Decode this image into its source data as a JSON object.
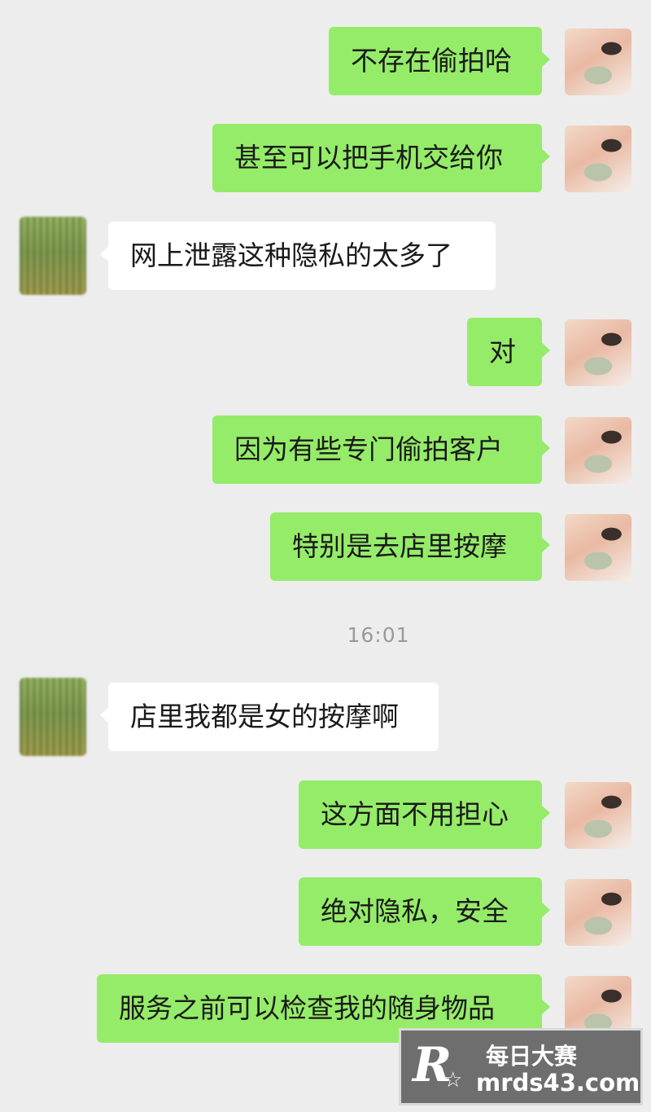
{
  "chat": {
    "messages": [
      {
        "side": "me",
        "text": "不存在偷拍哈"
      },
      {
        "side": "me",
        "text": "甚至可以把手机交给你"
      },
      {
        "side": "them",
        "text": "网上泄露这种隐私的太多了"
      },
      {
        "side": "me",
        "text": "对"
      },
      {
        "side": "me",
        "text": "因为有些专门偷拍客户"
      },
      {
        "side": "me",
        "text": "特别是去店里按摩"
      },
      {
        "side": "them",
        "text": "店里我都是女的按摩啊"
      },
      {
        "side": "me",
        "text": "这方面不用担心"
      },
      {
        "side": "me",
        "text": "绝对隐私，安全"
      },
      {
        "side": "me",
        "text": "服务之前可以检查我的随身物品"
      }
    ],
    "timestamp": "16:01"
  },
  "watermark": {
    "logo_letter": "R",
    "title": "每日大赛",
    "url": "mrds43.com"
  },
  "colors": {
    "background": "#ededed",
    "bubble_me": "#95ec69",
    "bubble_them": "#ffffff"
  }
}
